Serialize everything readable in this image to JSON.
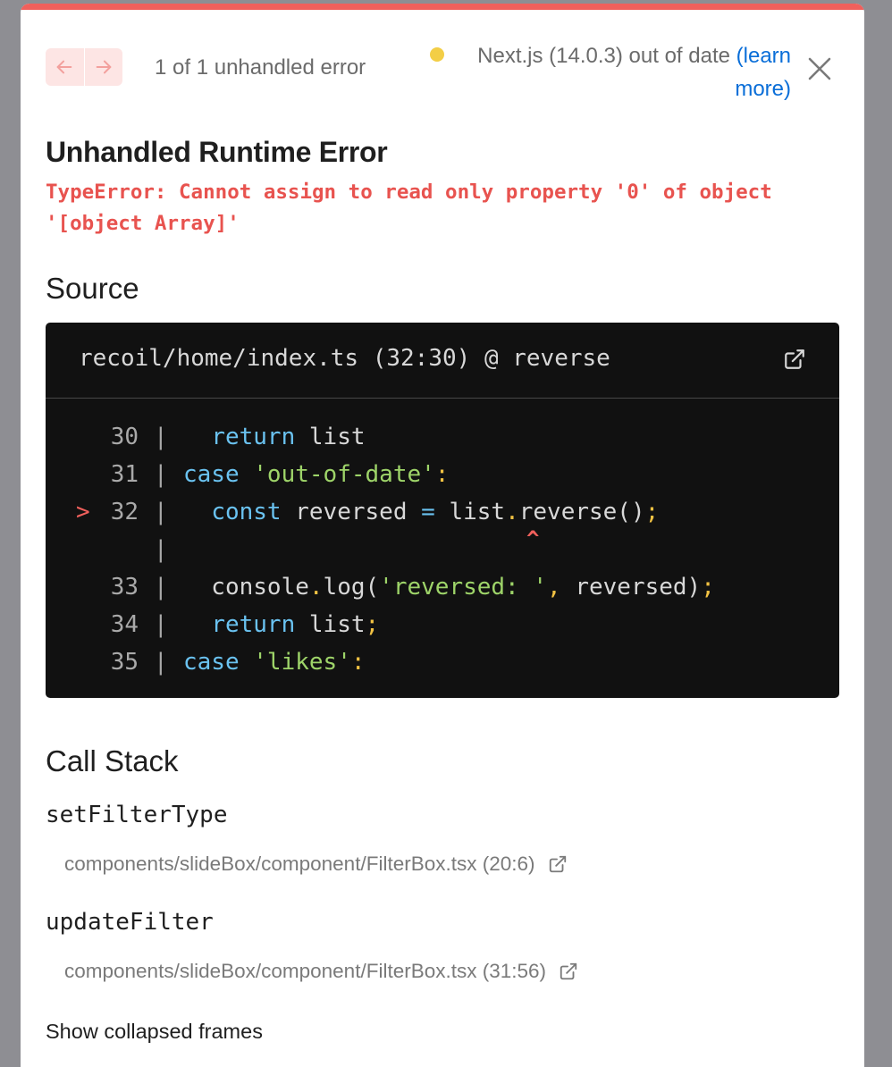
{
  "header": {
    "error_count": "1 of 1 unhandled error",
    "version_status": "Next.js (14.0.3) out of date",
    "learn_more": "(learn more)"
  },
  "error": {
    "title": "Unhandled Runtime Error",
    "message": "TypeError: Cannot assign to read only property '0' of object '[object Array]'"
  },
  "source": {
    "heading": "Source",
    "file": "recoil/home/index.ts (32:30) @ reverse",
    "active_marker": ">",
    "caret": "^",
    "pipe": "|",
    "lines": [
      {
        "no": "30",
        "tokens": [
          [
            "plain",
            "  "
          ],
          [
            "kw",
            "return"
          ],
          [
            "plain",
            " list"
          ]
        ]
      },
      {
        "no": "31",
        "tokens": [
          [
            "kw",
            "case"
          ],
          [
            "plain",
            " "
          ],
          [
            "str",
            "'out-of-date'"
          ],
          [
            "punct",
            ":"
          ]
        ]
      },
      {
        "no": "32",
        "tokens": [
          [
            "plain",
            "  "
          ],
          [
            "kw",
            "const"
          ],
          [
            "plain",
            " reversed "
          ],
          [
            "kw",
            "="
          ],
          [
            "plain",
            " list"
          ],
          [
            "punct",
            "."
          ],
          [
            "plain",
            "reverse()"
          ],
          [
            "punct",
            ";"
          ]
        ]
      },
      {
        "no": "33",
        "tokens": [
          [
            "plain",
            "  console"
          ],
          [
            "punct",
            "."
          ],
          [
            "plain",
            "log("
          ],
          [
            "str",
            "'reversed: '"
          ],
          [
            "punct",
            ","
          ],
          [
            "plain",
            " reversed)"
          ],
          [
            "punct",
            ";"
          ]
        ]
      },
      {
        "no": "34",
        "tokens": [
          [
            "plain",
            "  "
          ],
          [
            "kw",
            "return"
          ],
          [
            "plain",
            " list"
          ],
          [
            "punct",
            ";"
          ]
        ]
      },
      {
        "no": "35",
        "tokens": [
          [
            "kw",
            "case"
          ],
          [
            "plain",
            " "
          ],
          [
            "str",
            "'likes'"
          ],
          [
            "punct",
            ":"
          ]
        ]
      }
    ]
  },
  "call_stack": {
    "heading": "Call Stack",
    "frames": [
      {
        "name": "setFilterType",
        "location": "components/slideBox/component/FilterBox.tsx (20:6)"
      },
      {
        "name": "updateFilter",
        "location": "components/slideBox/component/FilterBox.tsx (31:56)"
      }
    ],
    "show_collapsed": "Show collapsed frames"
  },
  "colors": {
    "accent_red": "#f0605c",
    "link_blue": "#0a6ed8",
    "status_dot": "#f3ce46",
    "code_bg": "#111111",
    "keyword": "#6ac2f0",
    "string": "#9ed469",
    "punctuation": "#f2c243"
  },
  "icons": [
    "arrow-left-icon",
    "arrow-right-icon",
    "close-icon",
    "external-link-icon"
  ]
}
